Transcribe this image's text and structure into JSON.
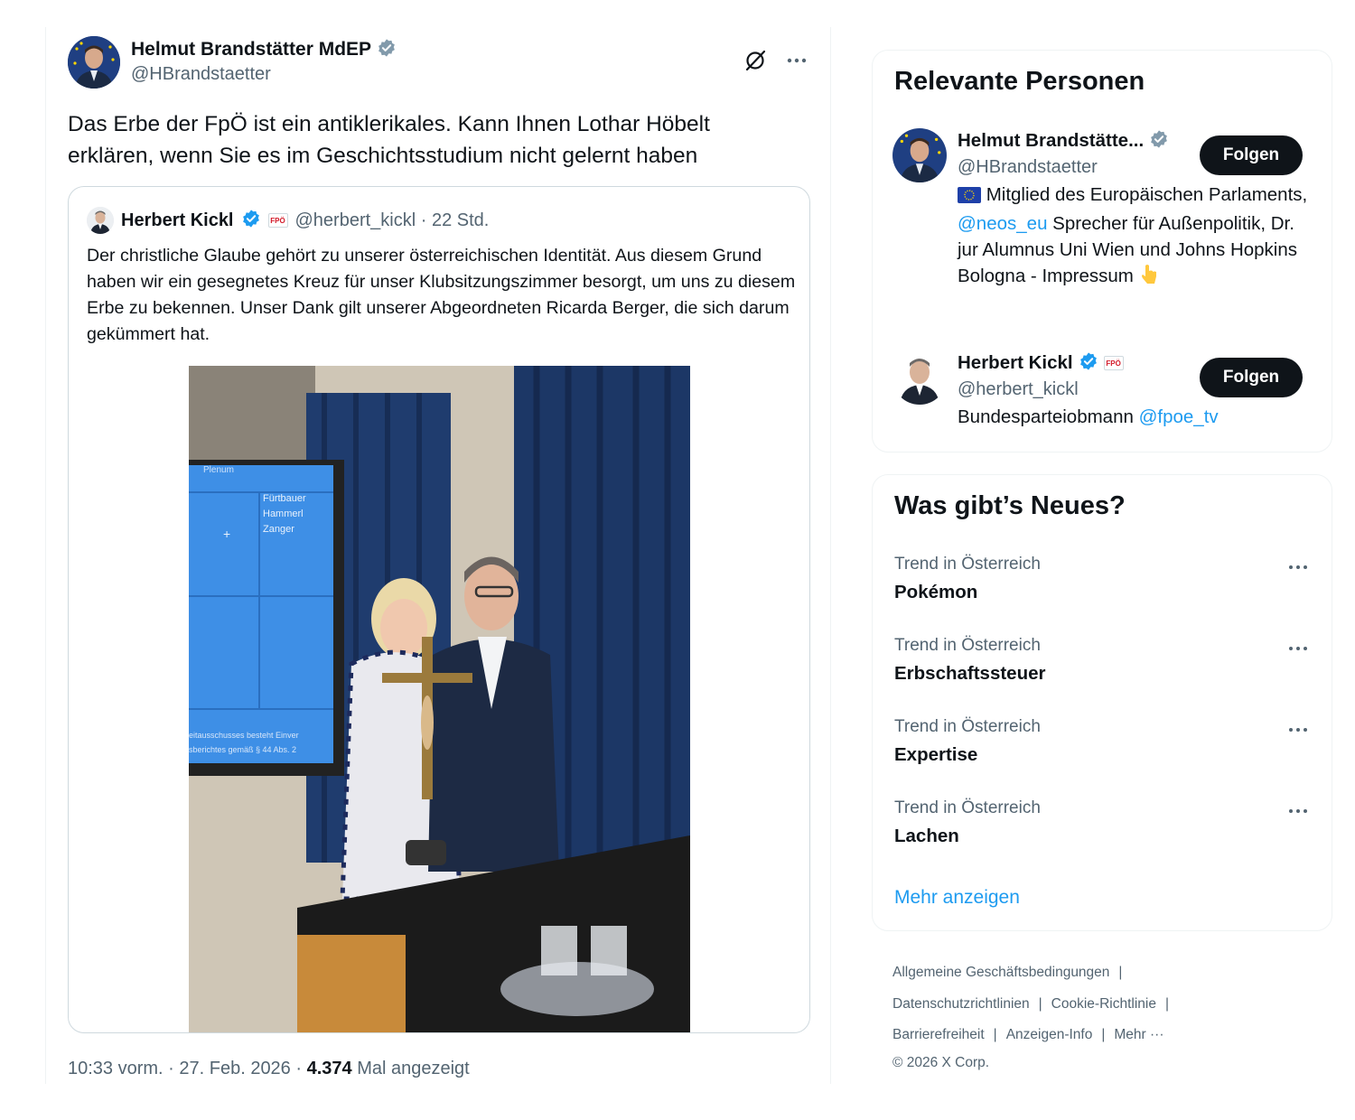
{
  "tweet": {
    "author_name": "Helmut Brandstätter MdEP",
    "author_handle": "@HBrandstaetter",
    "text": "Das Erbe der FpÖ ist ein antiklerikales. Kann Ihnen Lothar Höbelt erklären, wenn Sie es im Geschichtsstudium nicht gelernt haben",
    "time": "10:33 vorm. · 27. Feb. 2026 · ",
    "views_count": "4.374",
    "views_label": " Mal angezeigt"
  },
  "quote": {
    "author_name": "Herbert Kickl",
    "badge": "FPÖ",
    "author_handle": "@herbert_kickl · 22 Std.",
    "text": "Der christliche Glaube gehört zu unserer österreichischen Identität. Aus diesem Grund haben wir ein gesegnetes Kreuz für unser Klubsitzungszimmer besorgt, um uns zu diesem Erbe zu bekennen. Unser Dank gilt unserer Abgeordneten Ricarda Berger, die sich darum gekümmert hat.",
    "photo_screen": {
      "line1": "Plenum",
      "names": [
        "Fürtbauer",
        "Hammerl",
        "Zanger"
      ],
      "plus": "+",
      "footer1": "eitausschusses besteht Einver",
      "footer2": "sberichtes gemäß § 44 Abs. 2"
    }
  },
  "sidebar": {
    "persons_title": "Relevante Personen",
    "persons": [
      {
        "name": "Helmut Brandstätte...",
        "handle": "@HBrandstaetter",
        "bio_pre": " Mitglied des Europäischen Parlaments, ",
        "bio_link": "@neos_eu",
        "bio_post": " Sprecher für Außenpolitik, Dr. jur Alumnus Uni Wien und Johns Hopkins Bologna - Impressum ",
        "follow": "Folgen"
      },
      {
        "name": "Herbert Kickl",
        "badge": "FPÖ",
        "handle": "@herbert_kickl",
        "bio_pre": "Bundesparteiobmann ",
        "bio_link": "@fpoe_tv",
        "follow": "Folgen"
      }
    ],
    "news_title": "Was gibt’s Neues?",
    "trends": [
      {
        "context": "Trend in Österreich",
        "name": "Pokémon"
      },
      {
        "context": "Trend in Österreich",
        "name": "Erbschaftssteuer"
      },
      {
        "context": "Trend in Österreich",
        "name": "Expertise"
      },
      {
        "context": "Trend in Österreich",
        "name": "Lachen"
      }
    ],
    "show_more": "Mehr anzeigen"
  },
  "footer": {
    "links": [
      "Allgemeine Geschäftsbedingungen",
      "Datenschutzrichtlinien",
      "Cookie-Richtlinie",
      "Barrierefreiheit",
      "Anzeigen-Info",
      "Mehr ···"
    ],
    "separator": "|",
    "copyright": "© 2026 X Corp."
  },
  "colors": {
    "accent": "#1d9bf0",
    "verified": "#1d9bf0",
    "verified_gov": "#829aab",
    "text": "#0f1419",
    "muted": "#536471",
    "button": "#0f1419"
  }
}
